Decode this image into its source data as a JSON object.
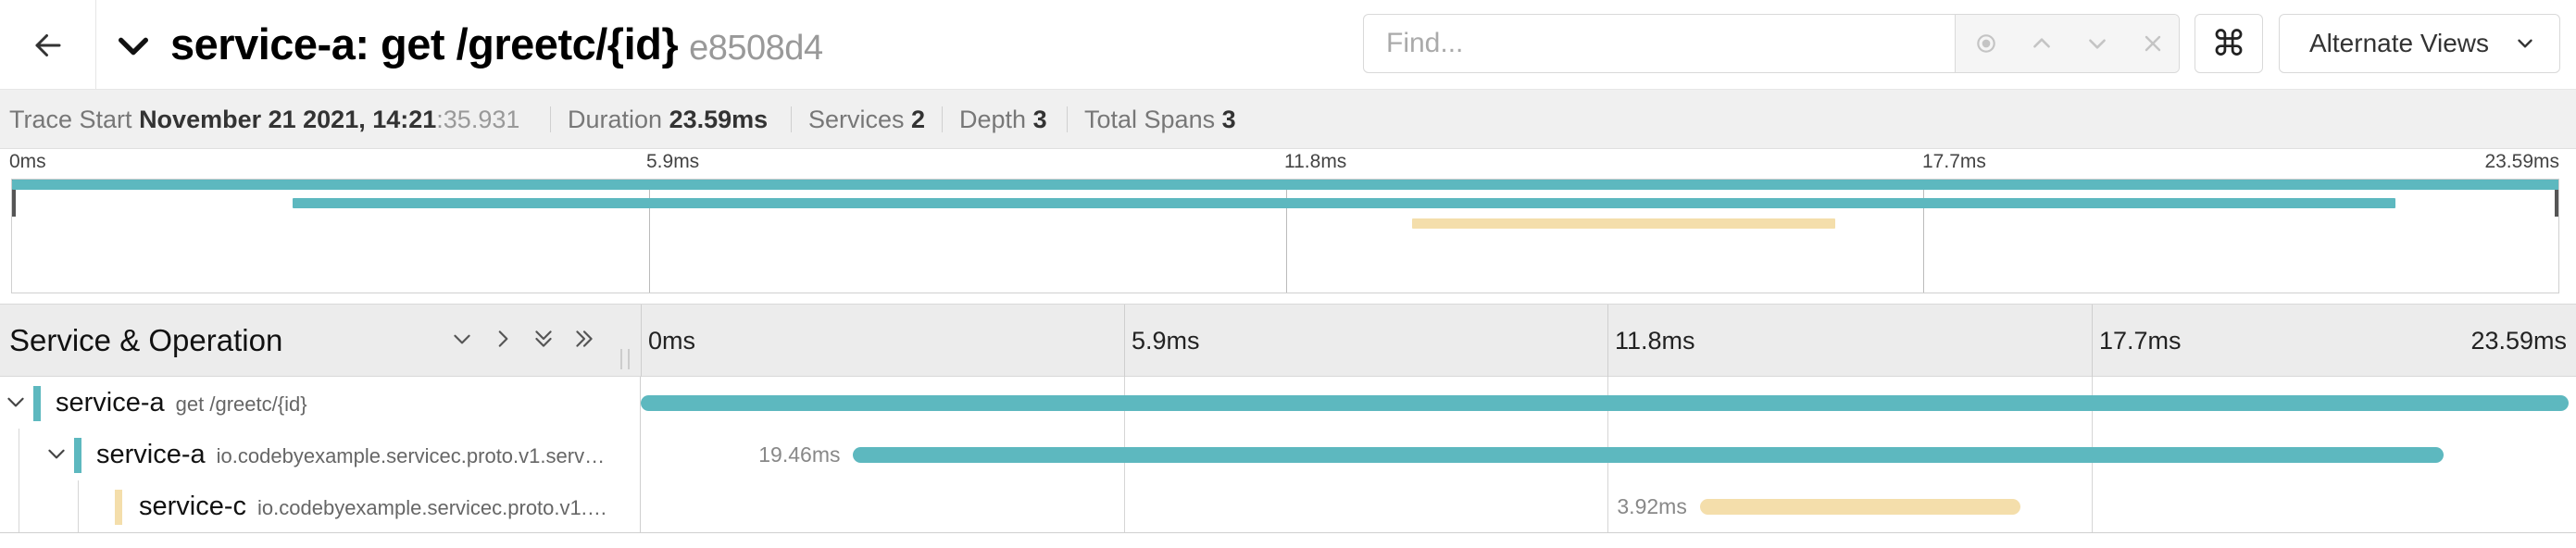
{
  "header": {
    "back_icon": "arrow-left-icon",
    "collapse_icon": "chevron-down-icon",
    "title": "service-a: get /greetc/{id}",
    "trace_id": "e8508d4",
    "search": {
      "placeholder": "Find...",
      "value": ""
    },
    "search_tools": [
      "locate-icon",
      "chevron-up-icon",
      "chevron-down-icon",
      "close-icon"
    ],
    "keyboard_shortcuts_icon": "command-icon",
    "keyboard_shortcuts_glyph": "⌘",
    "alternate_views_label": "Alternate Views"
  },
  "summary": {
    "trace_start_label": "Trace Start",
    "trace_start_value": "November 21 2021, 14:21",
    "trace_start_secs": ":35.931",
    "duration_label": "Duration",
    "duration_value": "23.59ms",
    "services_label": "Services",
    "services_value": "2",
    "depth_label": "Depth",
    "depth_value": "3",
    "total_spans_label": "Total Spans",
    "total_spans_value": "3"
  },
  "minimap": {
    "ticks": [
      "0ms",
      "5.9ms",
      "11.8ms",
      "17.7ms",
      "23.59ms"
    ]
  },
  "timeline": {
    "column_title": "Service & Operation",
    "tree_controls": [
      "chevron-down-icon",
      "chevron-right-icon",
      "double-chevron-down-icon",
      "double-chevron-right-icon"
    ],
    "ticks": [
      "0ms",
      "5.9ms",
      "11.8ms",
      "17.7ms",
      "23.59ms"
    ],
    "total_duration_ms": 23.59
  },
  "colors": {
    "service_a": "#5db8bf",
    "service_c": "#f4deab"
  },
  "spans": [
    {
      "service": "service-a",
      "operation": "get /greetc/{id}",
      "depth": 0,
      "collapsible": true,
      "color": "#5db8bf",
      "start_ms": 0,
      "duration_ms": 23.59,
      "duration_label": ""
    },
    {
      "service": "service-a",
      "operation": "io.codebyexample.servicec.proto.v1.serv…",
      "depth": 1,
      "collapsible": true,
      "color": "#5db8bf",
      "start_ms": 2.6,
      "duration_ms": 19.46,
      "duration_label": "19.46ms"
    },
    {
      "service": "service-c",
      "operation": "io.codebyexample.servicec.proto.v1.…",
      "depth": 2,
      "collapsible": false,
      "color": "#f4deab",
      "start_ms": 12.96,
      "duration_ms": 3.92,
      "duration_label": "3.92ms"
    }
  ]
}
